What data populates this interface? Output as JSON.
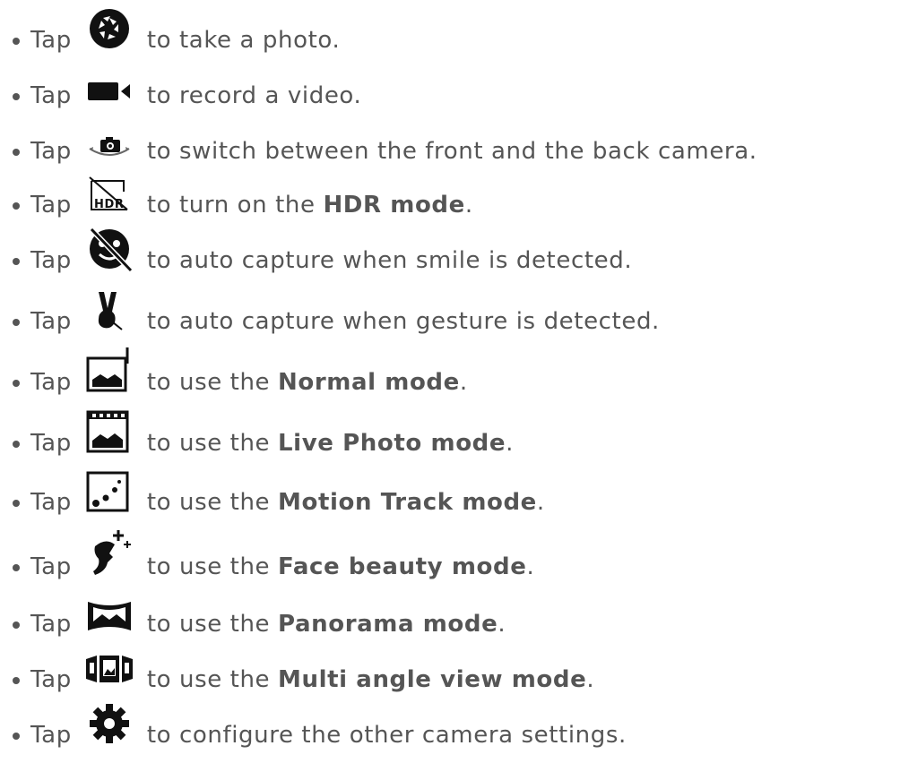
{
  "items": [
    {
      "tap": "Tap",
      "icon": "shutter-icon",
      "pre": "to take a photo.",
      "bold": "",
      "post": ""
    },
    {
      "tap": "Tap",
      "icon": "video-camera-icon",
      "pre": "to record a video.",
      "bold": "",
      "post": ""
    },
    {
      "tap": "Tap",
      "icon": "switch-camera-icon",
      "pre": "to switch between the front and the back camera.",
      "bold": "",
      "post": ""
    },
    {
      "tap": "Tap",
      "icon": "hdr-off-icon",
      "pre": "to turn on the ",
      "bold": "HDR mode",
      "post": "."
    },
    {
      "tap": "Tap",
      "icon": "smile-capture-off-icon",
      "pre": "to auto capture when smile is detected.",
      "bold": "",
      "post": ""
    },
    {
      "tap": "Tap",
      "icon": "gesture-capture-icon",
      "pre": "to auto capture when gesture is detected.",
      "bold": "",
      "post": ""
    },
    {
      "tap": "Tap",
      "icon": "normal-mode-icon",
      "pre": "to use the ",
      "bold": "Normal mode",
      "post": "."
    },
    {
      "tap": "Tap",
      "icon": "live-photo-icon",
      "pre": "to use the ",
      "bold": "Live Photo mode",
      "post": "."
    },
    {
      "tap": "Tap",
      "icon": "motion-track-icon",
      "pre": "to use the ",
      "bold": "Motion Track mode",
      "post": "."
    },
    {
      "tap": "Tap",
      "icon": "face-beauty-icon",
      "pre": "to use the ",
      "bold": "Face beauty mode",
      "post": "."
    },
    {
      "tap": "Tap",
      "icon": "panorama-icon",
      "pre": "to use the ",
      "bold": "Panorama mode",
      "post": "."
    },
    {
      "tap": "Tap",
      "icon": "multi-angle-icon",
      "pre": "to use the ",
      "bold": "Multi angle view mode",
      "post": "."
    },
    {
      "tap": "Tap",
      "icon": "settings-gear-icon",
      "pre": "to configure the other camera settings.",
      "bold": "",
      "post": ""
    }
  ]
}
